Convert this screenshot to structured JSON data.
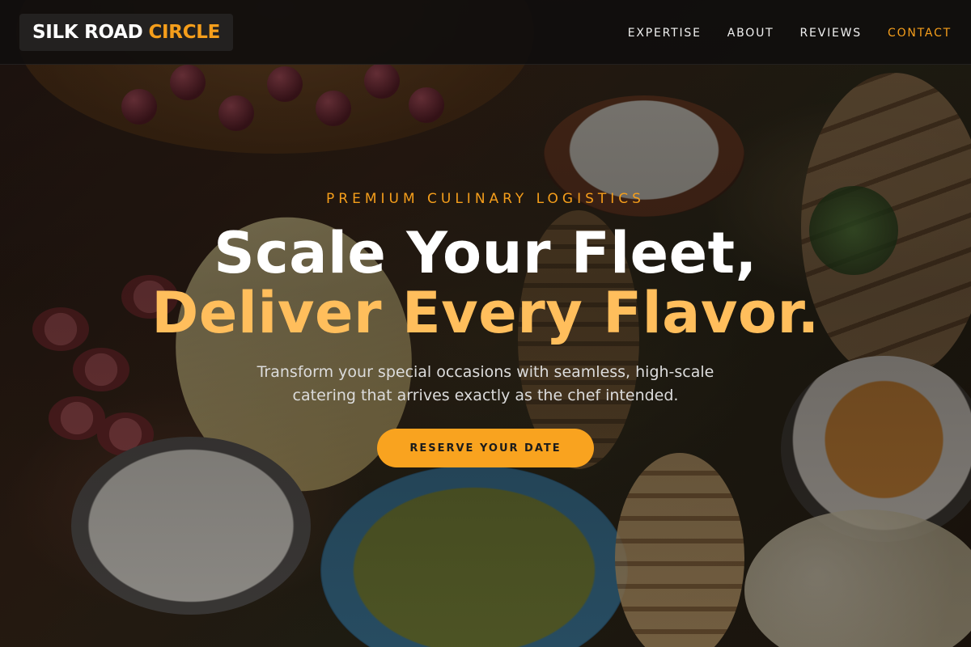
{
  "brand": {
    "name_primary": "SILK ROAD",
    "name_accent": "CIRCLE",
    "accent_color": "#f59e1b"
  },
  "nav": {
    "items": [
      {
        "label": "EXPERTISE",
        "active": false
      },
      {
        "label": "ABOUT",
        "active": false
      },
      {
        "label": "REVIEWS",
        "active": false
      },
      {
        "label": "CONTACT",
        "active": true
      }
    ]
  },
  "hero": {
    "eyebrow": "PREMIUM CULINARY LOGISTICS",
    "headline_line1": "Scale Your Fleet,",
    "headline_line2": "Deliver Every Flavor.",
    "subtitle": "Transform your special occasions with seamless, high-scale catering that arrives exactly as the chef intended.",
    "cta_label": "RESERVE YOUR DATE",
    "cta_color": "#f9a31f",
    "headline_accent_color": "#ffbe5c"
  }
}
